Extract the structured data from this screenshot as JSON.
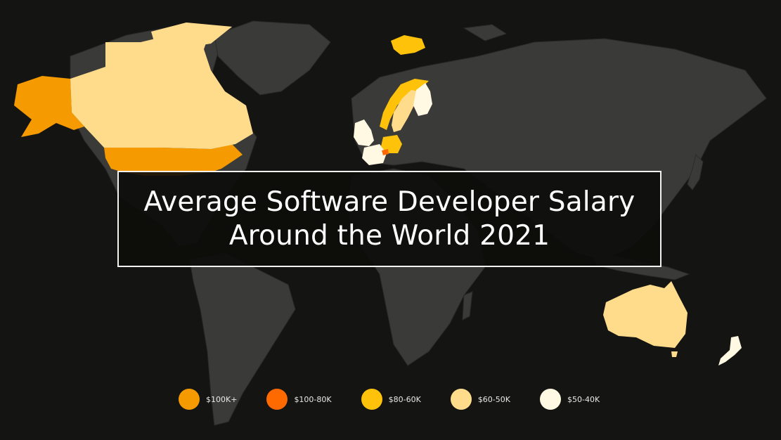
{
  "colors": {
    "background": "#141412",
    "land": "#3a3a38",
    "tier_100k_plus": "#f59a00",
    "tier_100_80k": "#ff6a00",
    "tier_80_60k": "#ffc20a",
    "tier_60_50k": "#ffdc8c",
    "tier_50_40k": "#fff8e2"
  },
  "title": {
    "line1": "Average Software Developer Salary",
    "line2": "Around the World 2021"
  },
  "legend": [
    {
      "label": "$100K+",
      "color": "#f59a00"
    },
    {
      "label": "$100-80K",
      "color": "#ff6a00"
    },
    {
      "label": "$80-60K",
      "color": "#ffc20a"
    },
    {
      "label": "$60-50K",
      "color": "#ffdc8c"
    },
    {
      "label": "$50-40K",
      "color": "#fff8e2"
    }
  ]
}
